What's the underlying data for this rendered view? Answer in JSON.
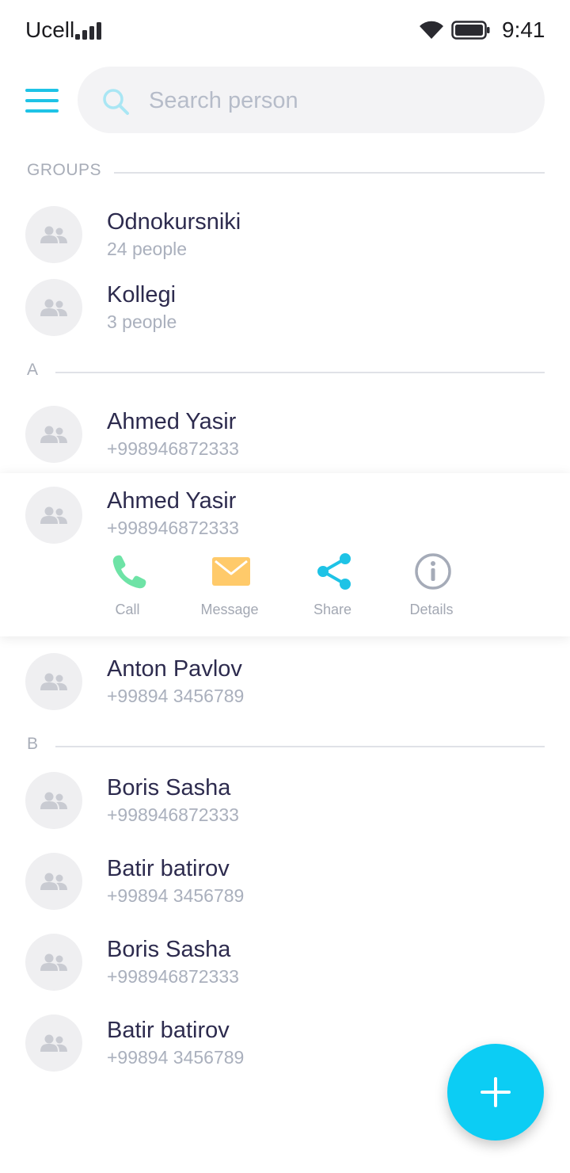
{
  "status_bar": {
    "carrier": "Ucell",
    "time": "9:41"
  },
  "search": {
    "placeholder": "Search person"
  },
  "sections": {
    "groups": "GROUPS",
    "a": "A",
    "b": "B"
  },
  "groups": [
    {
      "name": "Odnokursniki",
      "count": "24 people"
    },
    {
      "name": "Kollegi",
      "count": "3 people"
    }
  ],
  "contacts_a": [
    {
      "name": "Ahmed Yasir",
      "phone": "+998946872333"
    },
    {
      "name": "Ahmed Yasir",
      "phone": "+998946872333"
    },
    {
      "name": "Anton Pavlov",
      "phone": "+99894 3456789"
    }
  ],
  "actions": {
    "call": "Call",
    "message": "Message",
    "share": "Share",
    "details": "Details"
  },
  "contacts_b": [
    {
      "name": "Boris Sasha",
      "phone": "+998946872333"
    },
    {
      "name": "Batir batirov",
      "phone": "+99894 3456789"
    },
    {
      "name": "Boris Sasha",
      "phone": "+998946872333"
    },
    {
      "name": "Batir batirov",
      "phone": "+99894 3456789"
    }
  ],
  "colors": {
    "accent": "#1ec3e6",
    "fab": "#0ccdf4",
    "call": "#6ee3a6",
    "message": "#ffca6a",
    "share": "#1ec3e6",
    "details": "#a5abb8",
    "name_text": "#2d2b4e",
    "sub_text": "#aab0bd"
  },
  "icons": {
    "menu": "hamburger-icon",
    "search": "search-icon",
    "avatar": "people-icon",
    "call": "phone-icon",
    "message": "mail-icon",
    "share": "share-icon",
    "details": "info-icon",
    "fab": "plus-icon"
  }
}
